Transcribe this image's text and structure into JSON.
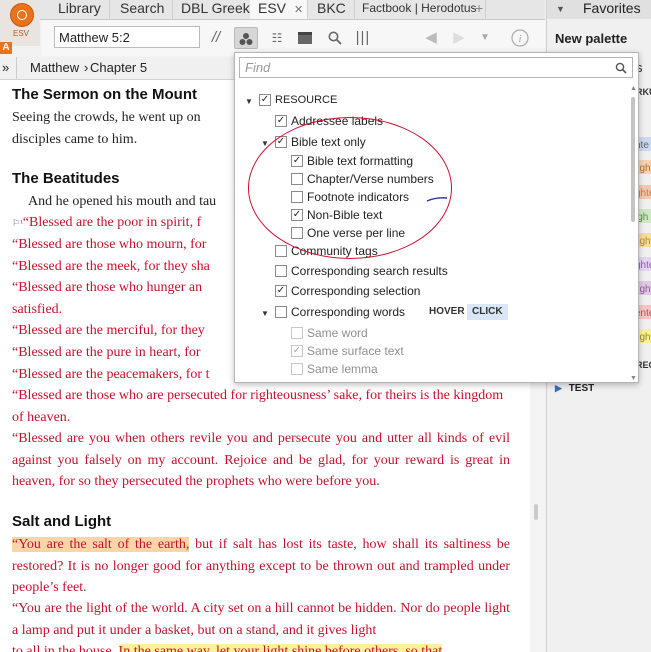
{
  "app": {
    "logo_label": "ESV",
    "logo_badge": "A"
  },
  "tabs": [
    {
      "label": "Library"
    },
    {
      "label": "Search"
    },
    {
      "label": "DBL Greek"
    },
    {
      "label": "ESV",
      "close": "✕"
    },
    {
      "label": "BKC"
    },
    {
      "label": "Factbook | Herodotus"
    },
    {
      "label": "+"
    }
  ],
  "toolbar": {
    "reference": "Matthew 5:2"
  },
  "breadcrumb": {
    "arrow": "»",
    "book": "Matthew",
    "sep": "›",
    "chapter": "Chapter 5"
  },
  "reader": {
    "heading1": "The Sermon on the Mount",
    "intro_a": "Seeing the crowds, he went up on",
    "intro_b": "disciples came to him.",
    "heading2": "The Beatitudes",
    "v2": "And he opened his mouth and tau",
    "v3": "“Blessed are the poor in spirit, f",
    "v4": "“Blessed are those who mourn, for",
    "v5": "“Blessed are the meek, for they sha",
    "v6a": "“Blessed are those who hunger an",
    "v6b": "satisfied.",
    "v7": "“Blessed are the merciful, for they",
    "v8": "“Blessed are the pure in heart, for",
    "v9": "“Blessed are the peacemakers, for t",
    "v10": "“Blessed are those who are persecuted for righteousness’ sake, for theirs is the kingdom of heaven.",
    "v11": "“Blessed are you when others revile you and persecute you and utter all kinds of evil against you falsely on my account. Rejoice and be glad, for your reward is great in heaven, for so they persecuted the prophets who were before you.",
    "heading3": "Salt and Light",
    "v13_hl": "“You are the salt of the earth,",
    "v13_rest": " but if salt has lost its taste, how shall its saltiness be restored? It is no longer good for anything except to be thrown out and trampled under people’s feet.",
    "v14": "“You are the light of the world. A city set on a hill cannot be hidden. Nor do people light a lamp and put it under a basket, but on a stand, and it gives light",
    "v15_tail": "to all in the house.",
    "v16_hl": "In the same way, let your light shine before others, so that"
  },
  "right_panel": {
    "tab": "Favorites",
    "new_palette": "New palette",
    "partial_s": "s",
    "partial_rku": "RKU",
    "partial_rec": "REC",
    "test": "TEST",
    "swatch_labels": [
      "hte",
      "ligh",
      "ghte",
      "igh",
      "ligh",
      "ghte",
      "ligh",
      "ente",
      "ligh"
    ],
    "swatch_colors": [
      "#c9daf2",
      "#f6d3b0",
      "#f3c9ad",
      "#cfe8c4",
      "#f7dc9a",
      "#e7d3f3",
      "#e2c8e6",
      "#f8c5c5",
      "#fbf09a"
    ]
  },
  "dropdown": {
    "find_placeholder": "Find",
    "options": [
      {
        "label": "RESOURCE",
        "checked": true
      },
      {
        "label": "Addressee labels",
        "checked": true
      },
      {
        "label": "Bible text only",
        "checked": true
      },
      {
        "label": "Bible text formatting",
        "checked": true
      },
      {
        "label": "Chapter/Verse numbers",
        "checked": false
      },
      {
        "label": "Footnote indicators",
        "checked": false
      },
      {
        "label": "Non-Bible text",
        "checked": true
      },
      {
        "label": "One verse per line",
        "checked": false
      },
      {
        "label": "Community tags",
        "checked": false
      },
      {
        "label": "Corresponding search results",
        "checked": false
      },
      {
        "label": "Corresponding selection",
        "checked": true
      },
      {
        "label": "Corresponding words",
        "checked": false
      },
      {
        "label": "Same word",
        "checked": false
      },
      {
        "label": "Same surface text",
        "checked": true
      },
      {
        "label": "Same lemma",
        "checked": false
      }
    ],
    "hover_label": "HOVER",
    "click_label": "CLICK"
  }
}
